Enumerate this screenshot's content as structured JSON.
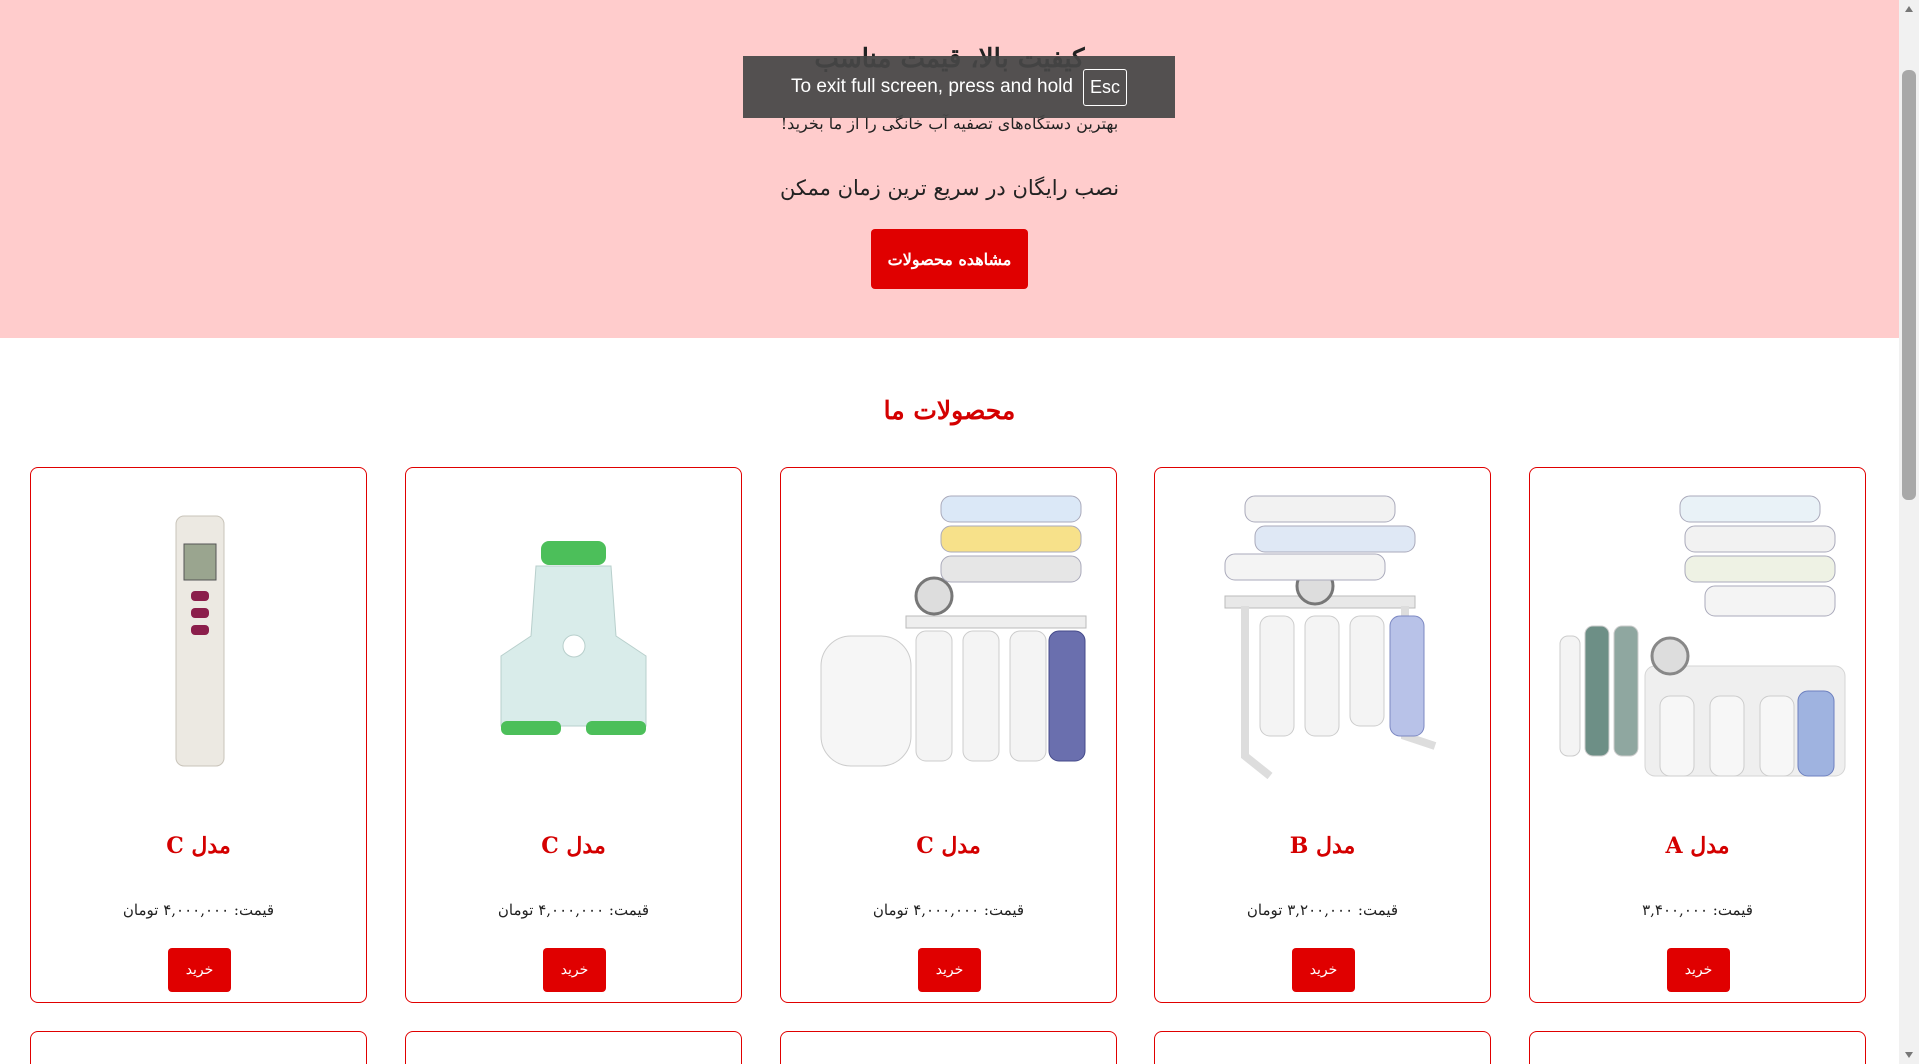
{
  "hero": {
    "title": "کیفیت بالا، قیمت مناسب",
    "subtitle": "بهترین دستگاه‌های تصفیه آب خانگی را از ما بخرید!",
    "note": "نصب رایگان در سریع ترین زمان ممکن",
    "cta_label": "مشاهده محصولات"
  },
  "fullscreen_toast": {
    "text": "To exit full screen, press and hold",
    "key": "Esc"
  },
  "products_section": {
    "title": "محصولات ما",
    "products": [
      {
        "name": "مدل A",
        "price": "قیمت: ۳,۴۰۰,۰۰۰",
        "buy_label": "خرید",
        "image": "ro-filter-with-cartridges"
      },
      {
        "name": "مدل B",
        "price": "قیمت: ۳,۲۰۰,۰۰۰ تومان",
        "buy_label": "خرید",
        "image": "ro-filter-on-stand"
      },
      {
        "name": "مدل C",
        "price": "قیمت: ۴,۰۰۰,۰۰۰ تومان",
        "buy_label": "خرید",
        "image": "ro-filter-with-tank"
      },
      {
        "name": "مدل C",
        "price": "قیمت: ۴,۰۰۰,۰۰۰ تومان",
        "buy_label": "خرید",
        "image": "pipe-connector"
      },
      {
        "name": "مدل C",
        "price": "قیمت: ۴,۰۰۰,۰۰۰ تومان",
        "buy_label": "خرید",
        "image": "tds-meter"
      }
    ]
  },
  "colors": {
    "accent": "#e00000",
    "hero_bg": "#ffcccc",
    "title_red": "#d40000"
  }
}
